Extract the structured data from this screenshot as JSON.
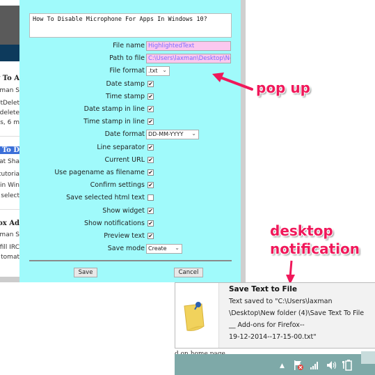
{
  "background_page": {
    "articles": [
      {
        "title": "y To A",
        "author": "xman S",
        "lines": [
          "tDelet",
          "delete",
          "s, 6 m"
        ]
      },
      {
        "title": "y To D",
        "author": "jat Sha",
        "lines": [
          "tutoria",
          "in Win",
          "select"
        ]
      },
      {
        "title": "fox Ad",
        "author": "xman S",
        "lines": [
          "fill IRC",
          "tomat"
        ]
      }
    ]
  },
  "popup": {
    "page_title": "How To Disable Microphone For Apps In Windows 10?",
    "fields": [
      {
        "label": "File name",
        "type": "text",
        "value": "HighlightedText"
      },
      {
        "label": "Path to file",
        "type": "text",
        "value": "C:\\Users\\laxman\\Desktop\\Ne"
      },
      {
        "label": "File format",
        "type": "select",
        "value": ".txt"
      },
      {
        "label": "Date stamp",
        "type": "checkbox",
        "checked": true
      },
      {
        "label": "Time stamp",
        "type": "checkbox",
        "checked": true
      },
      {
        "label": "Date stamp in line",
        "type": "checkbox",
        "checked": true
      },
      {
        "label": "Time stamp in line",
        "type": "checkbox",
        "checked": true
      },
      {
        "label": "Date format",
        "type": "select",
        "value": "DD-MM-YYYY"
      },
      {
        "label": "Line separator",
        "type": "checkbox",
        "checked": true
      },
      {
        "label": "Current URL",
        "type": "checkbox",
        "checked": true
      },
      {
        "label": "Use pagename as filename",
        "type": "checkbox",
        "checked": true
      },
      {
        "label": "Confirm settings",
        "type": "checkbox",
        "checked": true
      },
      {
        "label": "Save selected html text",
        "type": "checkbox",
        "checked": false
      },
      {
        "label": "Show widget",
        "type": "checkbox",
        "checked": true
      },
      {
        "label": "Show notifications",
        "type": "checkbox",
        "checked": true
      },
      {
        "label": "Preview text",
        "type": "checkbox",
        "checked": true
      },
      {
        "label": "Save mode",
        "type": "select",
        "value": "Create"
      }
    ],
    "save_label": "Save",
    "cancel_label": "Cancel",
    "check_glyph": "✔",
    "chevron_glyph": "⌄"
  },
  "annotations": {
    "popup_label": "pop up",
    "notification_label_line1": "desktop",
    "notification_label_line2": "notification",
    "color": "#f0185a"
  },
  "notification": {
    "title": "Save Text to File",
    "lines": [
      "Text saved to \"C:\\Users\\laxman",
      "\\Desktop\\New folder (4)\\Save Text To File",
      "__ Add-ons for Firefox--",
      "19-12-2014--17-15-00.txt\""
    ]
  },
  "under_notification_text": "d on home page",
  "taskbar": {
    "tray_icons": [
      "chevron-up-icon",
      "action-center-flag-icon",
      "network-signal-icon",
      "volume-icon",
      "battery-icon"
    ],
    "color": "#7ea9a8"
  }
}
